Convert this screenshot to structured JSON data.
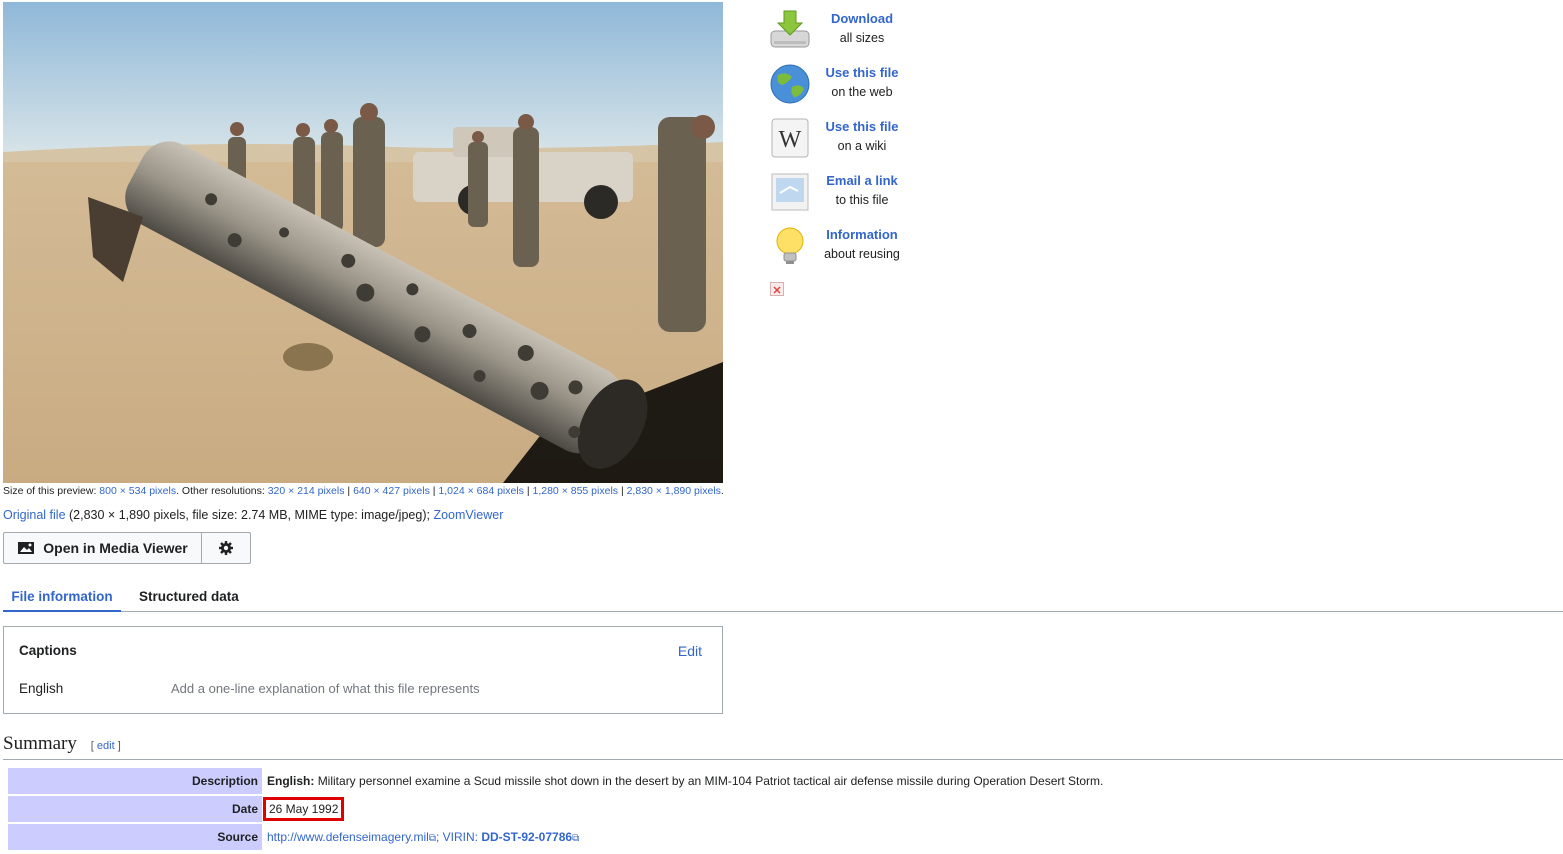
{
  "preview": {
    "size_label": "Size of this preview:",
    "size_value": "800 × 534 pixels",
    "other_label": "Other resolutions:",
    "resolutions": [
      "320 × 214 pixels",
      "640 × 427 pixels",
      "1,024 × 684 pixels",
      "1,280 × 855 pixels",
      "2,830 × 1,890 pixels"
    ]
  },
  "original": {
    "link": "Original file",
    "details": "(2,830 × 1,890 pixels, file size: 2.74 MB, MIME type: image/jpeg);",
    "zoom": "ZoomViewer"
  },
  "media_viewer": {
    "open_label": "Open in Media Viewer"
  },
  "tabs": [
    {
      "label": "File information",
      "active": true
    },
    {
      "label": "Structured data",
      "active": false
    }
  ],
  "captions": {
    "title": "Captions",
    "edit": "Edit",
    "language": "English",
    "placeholder": "Add a one-line explanation of what this file represents"
  },
  "summary": {
    "title": "Summary",
    "edit": "[ edit ]",
    "rows": {
      "description_label": "Description",
      "description_lang": "English:",
      "description_text": "Military personnel examine a Scud missile shot down in the desert by an MIM-104 Patriot tactical air defense missile during Operation Desert Storm.",
      "date_label": "Date",
      "date_value": "26 May 1992",
      "source_label": "Source",
      "source_url": "http://www.defenseimagery.mil",
      "source_sep": "; VIRIN:",
      "source_virin": "DD-ST-92-07786"
    }
  },
  "actions": [
    {
      "title": "Download",
      "sub": "all sizes",
      "icon": "download-icon"
    },
    {
      "title": "Use this file",
      "sub": "on the web",
      "icon": "globe-icon"
    },
    {
      "title": "Use this file",
      "sub": "on a wiki",
      "icon": "wikipedia-icon"
    },
    {
      "title": "Email a link",
      "sub": "to this file",
      "icon": "email-icon"
    },
    {
      "title": "Information",
      "sub": "about reusing",
      "icon": "lightbulb-icon"
    }
  ],
  "colors": {
    "link": "#3366cc",
    "label_bg": "#ccccff",
    "highlight": "#e00000"
  }
}
